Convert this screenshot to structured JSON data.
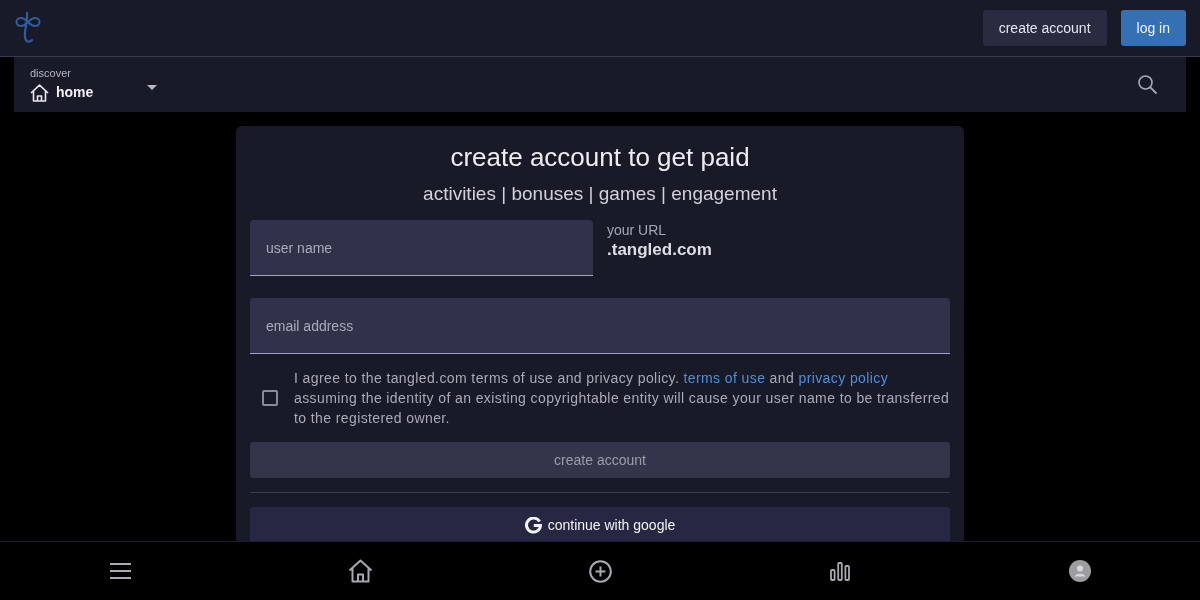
{
  "header": {
    "buttons": [
      {
        "label": "create account",
        "kind": "secondary"
      },
      {
        "label": "log in",
        "kind": "primary"
      }
    ]
  },
  "subbar": {
    "dropdown": {
      "caption": "discover",
      "value": "home"
    }
  },
  "form": {
    "title": "create account to get paid",
    "subtitle": "activities | bonuses | games | engagement",
    "username": {
      "placeholder": "user name"
    },
    "url": {
      "label": "your URL",
      "domain": ".tangled.com"
    },
    "email": {
      "placeholder": "email address"
    },
    "agreement": {
      "checked": false,
      "parts": [
        {
          "kind": "text",
          "text": "I agree to the tangled.com terms of use and privacy policy. "
        },
        {
          "kind": "link",
          "text": "terms of use"
        },
        {
          "kind": "text",
          "text": " and "
        },
        {
          "kind": "link",
          "text": "privacy policy"
        },
        {
          "kind": "text",
          "text": " assuming the identity of an existing copyrightable entity will cause your user name to be transferred to the registered owner."
        }
      ]
    },
    "submit": {
      "label": "create account",
      "disabled": true
    },
    "google": {
      "label": "continue with google"
    }
  }
}
